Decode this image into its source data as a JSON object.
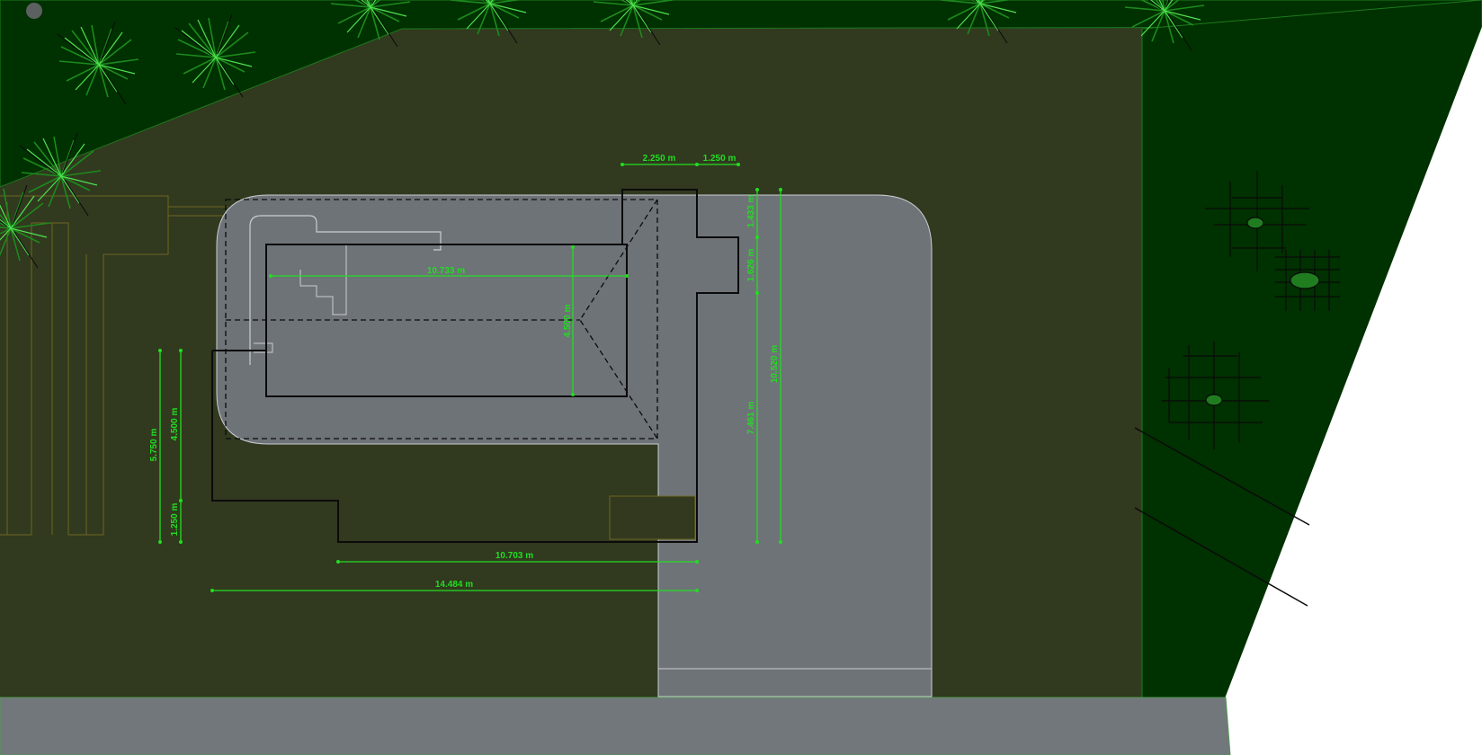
{
  "colors": {
    "lawn": "#31391f",
    "hedge": "#003100",
    "paving": "#6e7378",
    "road": "#72777c",
    "dimension": "#22dd22",
    "outline": "#0b0b0b",
    "background": "#ffffff"
  },
  "icons": [
    "grass-tuft-icon",
    "tree-symbol-icon"
  ],
  "dimensions": {
    "top_left": "2.250 m",
    "top_right": "1.250 m",
    "pool_length": "10.733 m",
    "pool_width": "4.500 m",
    "right_1433": "1.433 m",
    "right_1626": "1.626 m",
    "right_7461": "7.461 m",
    "right_10520": "10.520 m",
    "left_5750": "5.750 m",
    "left_4500": "4.500 m",
    "left_1250": "1.250 m",
    "bottom_10703": "10.703 m",
    "bottom_14484": "14.484 m"
  }
}
